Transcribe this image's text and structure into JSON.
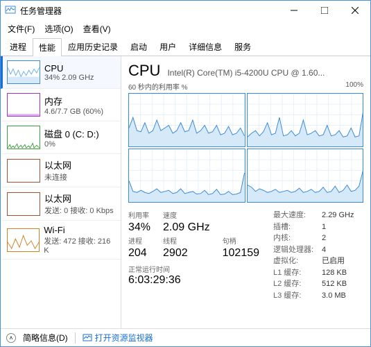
{
  "window": {
    "title": "任务管理器"
  },
  "menu": {
    "file": "文件(F)",
    "options": "选项(O)",
    "view": "查看(V)"
  },
  "tabs": {
    "processes": "进程",
    "performance": "性能",
    "apphistory": "应用历史记录",
    "startup": "启动",
    "users": "用户",
    "details": "详细信息",
    "services": "服务"
  },
  "sidebar": {
    "cpu": {
      "title": "CPU",
      "sub": "34%  2.09 GHz"
    },
    "mem": {
      "title": "内存",
      "sub": "4.6/7.7 GB (60%)"
    },
    "disk": {
      "title": "磁盘 0 (C: D:)",
      "sub": "0%"
    },
    "eth1": {
      "title": "以太网",
      "sub": "未连接"
    },
    "eth2": {
      "title": "以太网",
      "sub": "发送: 0 接收: 0 Kbps"
    },
    "wifi": {
      "title": "Wi-Fi",
      "sub": "发送: 472 接收: 216 K"
    }
  },
  "main": {
    "heading": "CPU",
    "model": "Intel(R) Core(TM) i5-4200U CPU @ 1.60...",
    "chartLeft": "60 秒内的利用率 %",
    "chartRight": "100%",
    "labels": {
      "util": "利用率",
      "speed": "速度",
      "procs": "进程",
      "threads": "线程",
      "handles": "句柄",
      "uptime": "正常运行时间"
    },
    "values": {
      "util": "34%",
      "speed": "2.09 GHz",
      "procs": "204",
      "threads": "2902",
      "handles": "102159",
      "uptime": "6:03:29:36"
    },
    "right": {
      "maxspeed_k": "最大速度:",
      "maxspeed_v": "2.29 GHz",
      "sockets_k": "插槽:",
      "sockets_v": "1",
      "cores_k": "内核:",
      "cores_v": "2",
      "lprocs_k": "逻辑处理器:",
      "lprocs_v": "4",
      "virt_k": "虚拟化:",
      "virt_v": "已启用",
      "l1_k": "L1 缓存:",
      "l1_v": "128 KB",
      "l2_k": "L2 缓存:",
      "l2_v": "512 KB",
      "l3_k": "L3 缓存:",
      "l3_v": "3.0 MB"
    }
  },
  "statusbar": {
    "less": "简略信息(D)",
    "resmon": "打开资源监视器"
  },
  "chart_data": [
    {
      "type": "area",
      "title": "CPU core 0 utilization",
      "ylim": [
        0,
        100
      ],
      "x": "seconds 0-60",
      "values": [
        35,
        55,
        30,
        28,
        45,
        25,
        30,
        50,
        30,
        35,
        40,
        25,
        30,
        45,
        28,
        30,
        50,
        25,
        30,
        40,
        25,
        28,
        40,
        22,
        25,
        38,
        22,
        25,
        35,
        20
      ]
    },
    {
      "type": "area",
      "title": "CPU core 1 utilization",
      "ylim": [
        0,
        100
      ],
      "x": "seconds 0-60",
      "values": [
        18,
        25,
        30,
        20,
        28,
        45,
        22,
        25,
        55,
        20,
        22,
        30,
        20,
        25,
        50,
        22,
        25,
        30,
        20,
        22,
        40,
        20,
        22,
        30,
        18,
        20,
        35,
        18,
        20,
        65
      ]
    },
    {
      "type": "area",
      "title": "CPU core 2 utilization",
      "ylim": [
        0,
        100
      ],
      "x": "seconds 0-60",
      "values": [
        40,
        20,
        18,
        22,
        18,
        16,
        20,
        25,
        18,
        20,
        22,
        16,
        18,
        25,
        16,
        18,
        20,
        15,
        16,
        22,
        14,
        16,
        24,
        14,
        15,
        20,
        14,
        15,
        18,
        55
      ]
    },
    {
      "type": "area",
      "title": "CPU core 3 utilization",
      "ylim": [
        0,
        100
      ],
      "x": "seconds 0-60",
      "values": [
        32,
        28,
        20,
        25,
        22,
        18,
        20,
        24,
        18,
        20,
        22,
        18,
        20,
        26,
        18,
        20,
        24,
        18,
        20,
        28,
        18,
        20,
        30,
        18,
        22,
        32,
        20,
        22,
        30,
        60
      ]
    }
  ]
}
